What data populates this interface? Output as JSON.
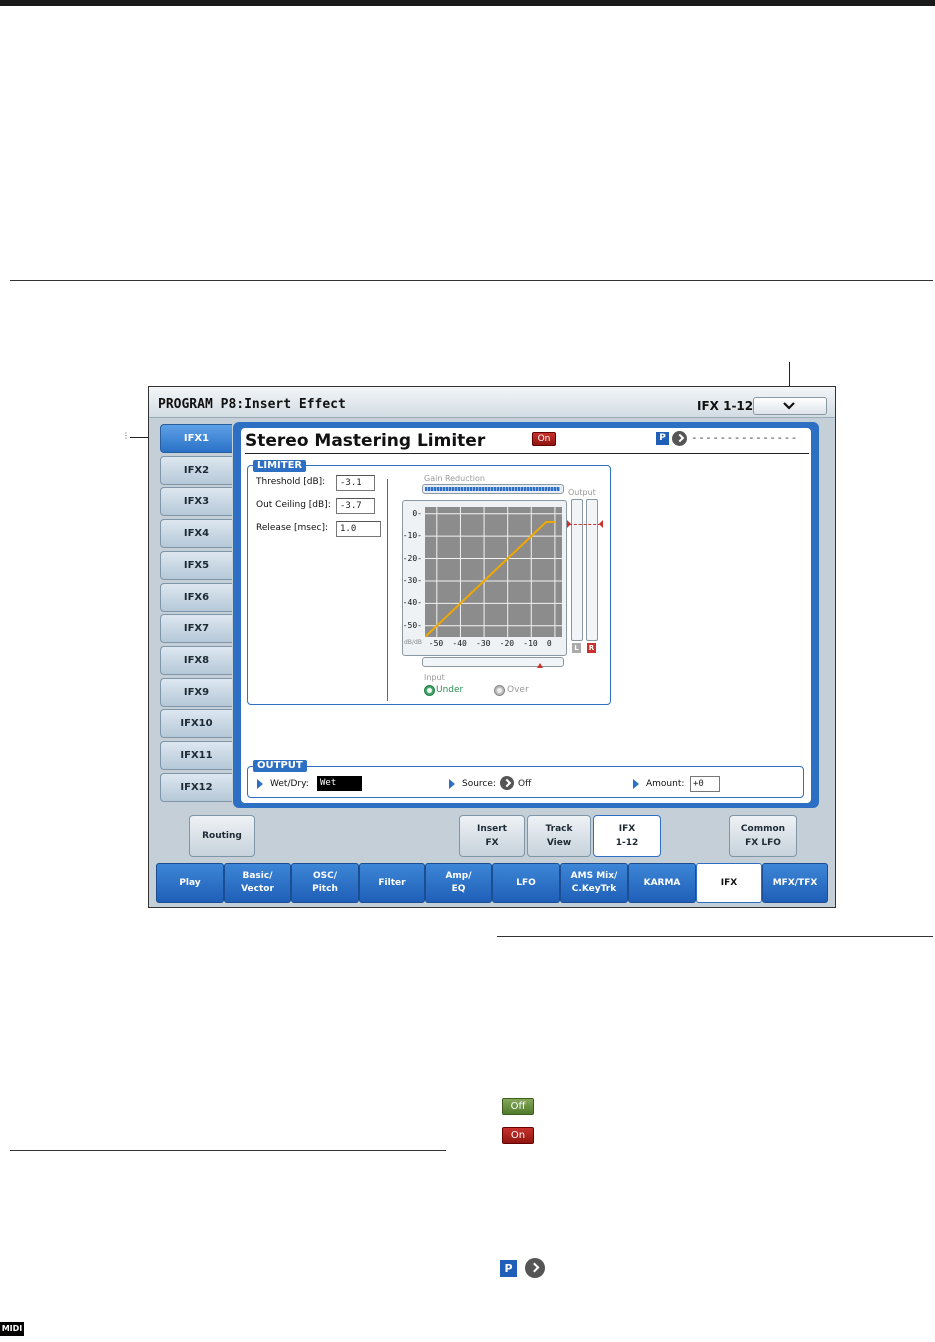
{
  "window": {
    "title": "PROGRAM P8:Insert Effect",
    "page": "IFX 1-12"
  },
  "ifx_tabs": [
    "IFX1",
    "IFX2",
    "IFX3",
    "IFX4",
    "IFX5",
    "IFX6",
    "IFX7",
    "IFX8",
    "IFX9",
    "IFX10",
    "IFX11",
    "IFX12"
  ],
  "ifx_selected": "IFX1",
  "effect": {
    "name": "Stereo Mastering Limiter",
    "on_label": "On",
    "p_label": "P",
    "p_dashes": "---------------"
  },
  "limiter": {
    "label": "LIMITER",
    "params": [
      {
        "label": "Threshold [dB]:",
        "value": "-3.1"
      },
      {
        "label": "Out Ceiling [dB]:",
        "value": "-3.7"
      },
      {
        "label": "Release [msec]:",
        "value": "1.0"
      }
    ],
    "gain_reduction_label": "Gain Reduction",
    "output_label": "Output",
    "input_label": "Input",
    "meter_l": "L",
    "meter_r": "R",
    "db_label": "dB/dB",
    "y_ticks": [
      "0-",
      "-10-",
      "-20-",
      "-30-",
      "-40-",
      "-50-"
    ],
    "x_ticks": [
      "-50",
      "-40",
      "-30",
      "-20",
      "-10",
      "0"
    ],
    "radio_under": "Under",
    "radio_over": "Over",
    "radio_selected": "Under",
    "curve": {
      "x": [
        -55,
        -3.7,
        0
      ],
      "y": [
        -55,
        -3.7,
        -3.7
      ]
    }
  },
  "output": {
    "label": "OUTPUT",
    "wetdry_label": "Wet/Dry:",
    "wetdry_value": "Wet",
    "source_label": "Source:",
    "source_value": "Off",
    "amount_label": "Amount:",
    "amount_value": "+0"
  },
  "upper_tabs": [
    {
      "label": "Routing"
    },
    {
      "label": "Insert\nFX"
    },
    {
      "label": "Track\nView"
    },
    {
      "label": "IFX\n1-12",
      "selected": true
    },
    {
      "label": "Common\nFX LFO"
    }
  ],
  "bottom_tabs": [
    {
      "label": "Play"
    },
    {
      "label": "Basic/\nVector"
    },
    {
      "label": "OSC/\nPitch"
    },
    {
      "label": "Filter"
    },
    {
      "label": "Amp/\nEQ"
    },
    {
      "label": "LFO"
    },
    {
      "label": "AMS Mix/\nC.KeyTrk"
    },
    {
      "label": "KARMA"
    },
    {
      "label": "IFX",
      "selected": true
    },
    {
      "label": "MFX/TFX"
    }
  ],
  "side_icons": {
    "off": "Off",
    "on": "On",
    "p": "P"
  },
  "midi_badge": "MIDI",
  "callout_dots": "⋮",
  "colors": {
    "accent": "#2d6fc2",
    "on_red": "#c8312c",
    "off_green": "#5d8a33",
    "curve": "#f0a800",
    "graph_bg": "#8c8c8c"
  }
}
